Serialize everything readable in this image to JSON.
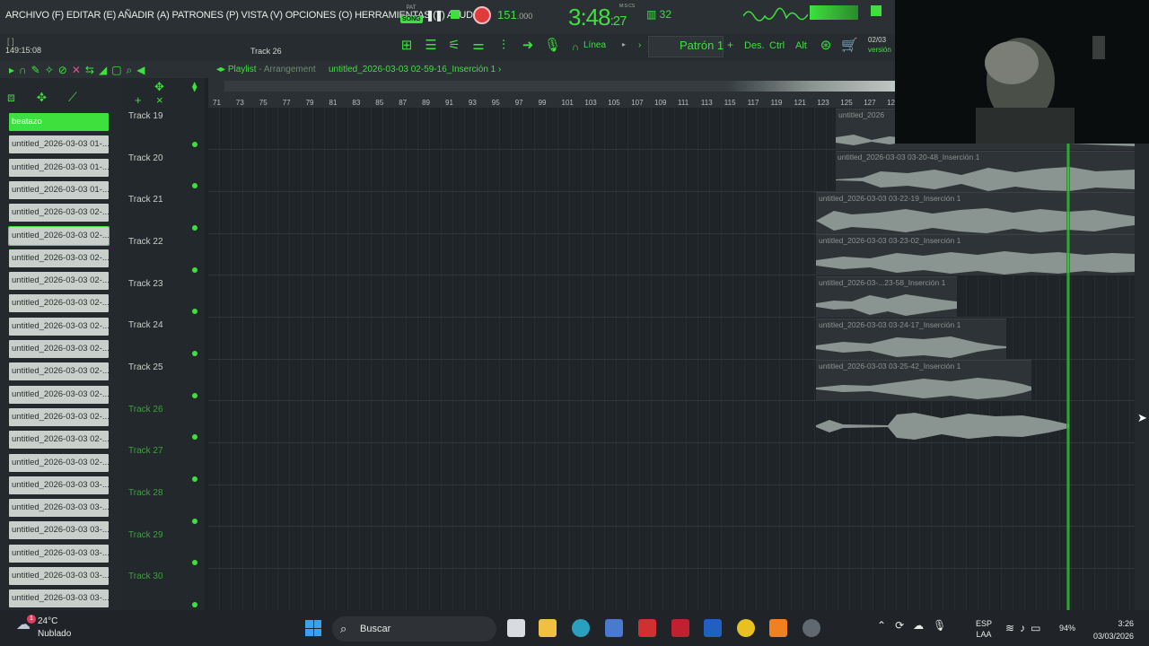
{
  "menu": {
    "text": "ARCHIVO (F) EDITAR (E) AÑADIR (A) PATRONES (P) VISTA (V) OPCIONES (O) HERRAMIENTAS (T) AYUDA"
  },
  "hint": {
    "bracket": "[ ]",
    "time": "149:15:08",
    "track": "Track 26"
  },
  "transport": {
    "pat_label": "PAT",
    "song_label": "SONG",
    "tempo": "151",
    "tempo_decimal": ".000",
    "clock_main": "3:48",
    "clock_sub": ":27",
    "clock_label": "M:S:CS",
    "cpu": "32",
    "pattern": "Patrón 1",
    "pattern_plus": "+",
    "snap": "Línea",
    "des": "Des.",
    "ctrl": "Ctrl",
    "alt": "Alt",
    "version_date": "02/03",
    "version_text": "versión"
  },
  "playlist": {
    "title": "Playlist",
    "subtitle": "- Arrangement",
    "file": "untitled_2026-03-03 02-59-16_Inserción 1",
    "file_arrow": "›"
  },
  "browser": {
    "items": [
      "beatazo",
      "untitled_2026-03-03 01-...",
      "untitled_2026-03-03 01-...",
      "untitled_2026-03-03 01-...",
      "untitled_2026-03-03 02-...",
      "untitled_2026-03-03 02-...",
      "untitled_2026-03-03 02-...",
      "untitled_2026-03-03 02-...",
      "untitled_2026-03-03 02-...",
      "untitled_2026-03-03 02-...",
      "untitled_2026-03-03 02-...",
      "untitled_2026-03-03 02-...",
      "untitled_2026-03-03 02-...",
      "untitled_2026-03-03 02-...",
      "untitled_2026-03-03 02-...",
      "untitled_2026-03-03 02-...",
      "untitled_2026-03-03 03-...",
      "untitled_2026-03-03 03-...",
      "untitled_2026-03-03 03-...",
      "untitled_2026-03-03 03-...",
      "untitled_2026-03-03 03-...",
      "untitled_2026-03-03 03-..."
    ]
  },
  "tracks": {
    "t19": "Track 19",
    "t20": "Track 20",
    "t21": "Track 21",
    "t22": "Track 22",
    "t23": "Track 23",
    "t24": "Track 24",
    "t25": "Track 25",
    "t26": "Track 26",
    "t27": "Track 27",
    "t28": "Track 28",
    "t29": "Track 29",
    "t30": "Track 30"
  },
  "ruler": {
    "numbers": [
      "71",
      "73",
      "75",
      "77",
      "79",
      "81",
      "83",
      "85",
      "87",
      "89",
      "91",
      "93",
      "95",
      "97",
      "99",
      "101",
      "103",
      "105",
      "107",
      "109",
      "111",
      "113",
      "115",
      "117",
      "119",
      "121",
      "123",
      "125",
      "127",
      "12"
    ]
  },
  "clips": {
    "c19": "untitled_2026",
    "c20": "untitled_2026-03-03 03-20-48_Inserción 1",
    "c21": "untitled_2026-03-03 03-22-19_Inserción 1",
    "c22": "untitled_2026-03-03 03-23-02_Inserción 1",
    "c23": "untitled_2026-03-...23-58_Inserción 1",
    "c24": "untitled_2026-03-03 03-24-17_Inserción 1",
    "c25": "untitled_2026-03-03 03-25-42_Inserción 1"
  },
  "taskbar": {
    "weather_badge": "1",
    "temperature": "24°C",
    "weather": "Nublado",
    "search": "Buscar",
    "lang1": "ESP",
    "lang2": "LAA",
    "battery": "94%",
    "time": "3:26",
    "date": "03/03/2026"
  },
  "colors": {
    "accent": "#3ee03e",
    "record": "#e03a3a",
    "background": "#1d2226"
  }
}
